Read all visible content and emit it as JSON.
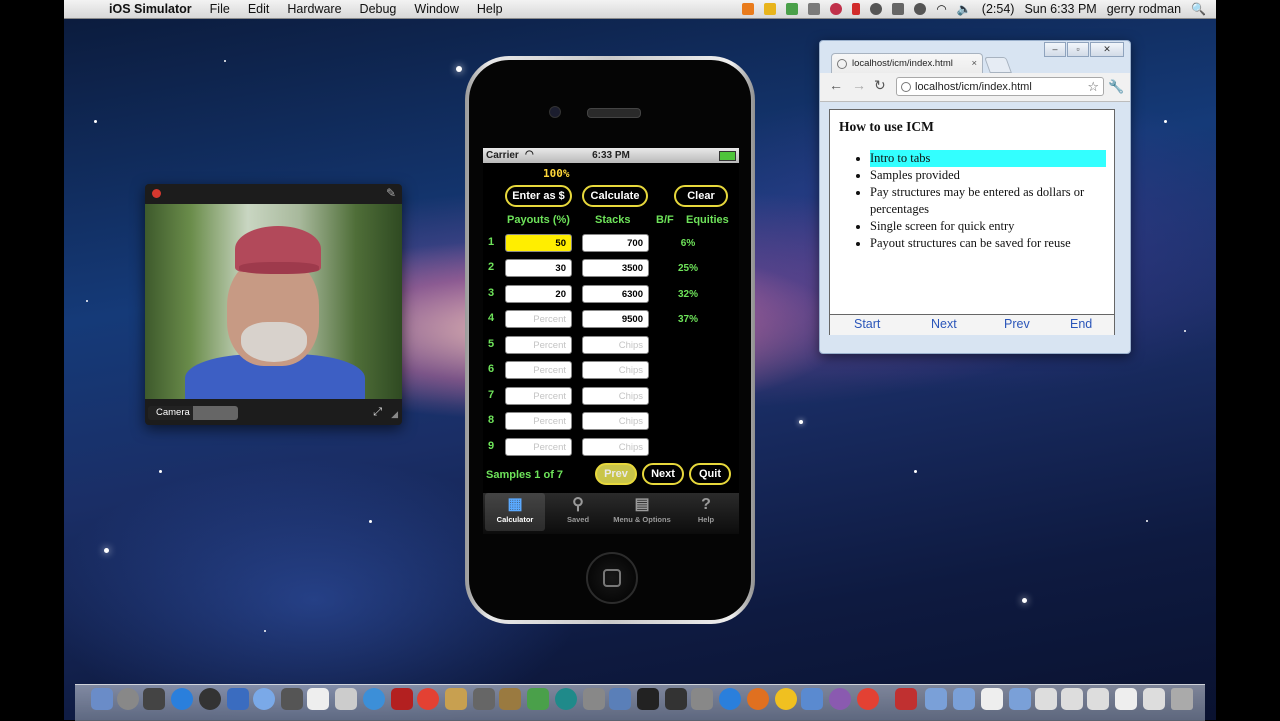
{
  "menubar": {
    "app_name": "iOS Simulator",
    "menus": [
      "File",
      "Edit",
      "Hardware",
      "Debug",
      "Window",
      "Help"
    ],
    "battery": "(2:54)",
    "clock": "Sun 6:33 PM",
    "user": "gerry rodman"
  },
  "webcam": {
    "label": "Camera"
  },
  "phone": {
    "status": {
      "carrier": "Carrier",
      "time": "6:33 PM"
    },
    "percent": "100%",
    "buttons": {
      "enter": "Enter as $",
      "calculate": "Calculate",
      "clear": "Clear"
    },
    "headers": {
      "payouts": "Payouts (%)",
      "stacks": "Stacks",
      "bf": "B/F",
      "equities": "Equities"
    },
    "rows": [
      {
        "num": "1",
        "payout": "50",
        "stack": "700",
        "equity": "6%"
      },
      {
        "num": "2",
        "payout": "30",
        "stack": "3500",
        "equity": "25%"
      },
      {
        "num": "3",
        "payout": "20",
        "stack": "6300",
        "equity": "32%"
      },
      {
        "num": "4",
        "payout": "Percent",
        "stack": "9500",
        "equity": "37%"
      },
      {
        "num": "5",
        "payout": "Percent",
        "stack": "Chips",
        "equity": ""
      },
      {
        "num": "6",
        "payout": "Percent",
        "stack": "Chips",
        "equity": ""
      },
      {
        "num": "7",
        "payout": "Percent",
        "stack": "Chips",
        "equity": ""
      },
      {
        "num": "8",
        "payout": "Percent",
        "stack": "Chips",
        "equity": ""
      },
      {
        "num": "9",
        "payout": "Percent",
        "stack": "Chips",
        "equity": ""
      }
    ],
    "samples": "Samples 1 of 7",
    "nav_buttons": {
      "prev": "Prev",
      "next": "Next",
      "quit": "Quit"
    },
    "tabs": [
      "Calculator",
      "Saved",
      "Menu & Options",
      "Help"
    ]
  },
  "browser": {
    "tab_title": "localhost/icm/index.html",
    "url": "localhost/icm/index.html",
    "heading": "How to use ICM",
    "items": [
      "Intro to tabs",
      "Samples provided",
      "Pay structures may be entered as dollars or percentages",
      "Single screen for quick entry",
      "Payout structures can be saved for reuse"
    ],
    "nav": [
      "Start",
      "Next",
      "Prev",
      "End"
    ]
  },
  "colors": {
    "accent_yellow": "#e7d83c",
    "text_green": "#6ee35a",
    "highlight_cyan": "#33ffff",
    "field_highlight": "#ffee00"
  }
}
